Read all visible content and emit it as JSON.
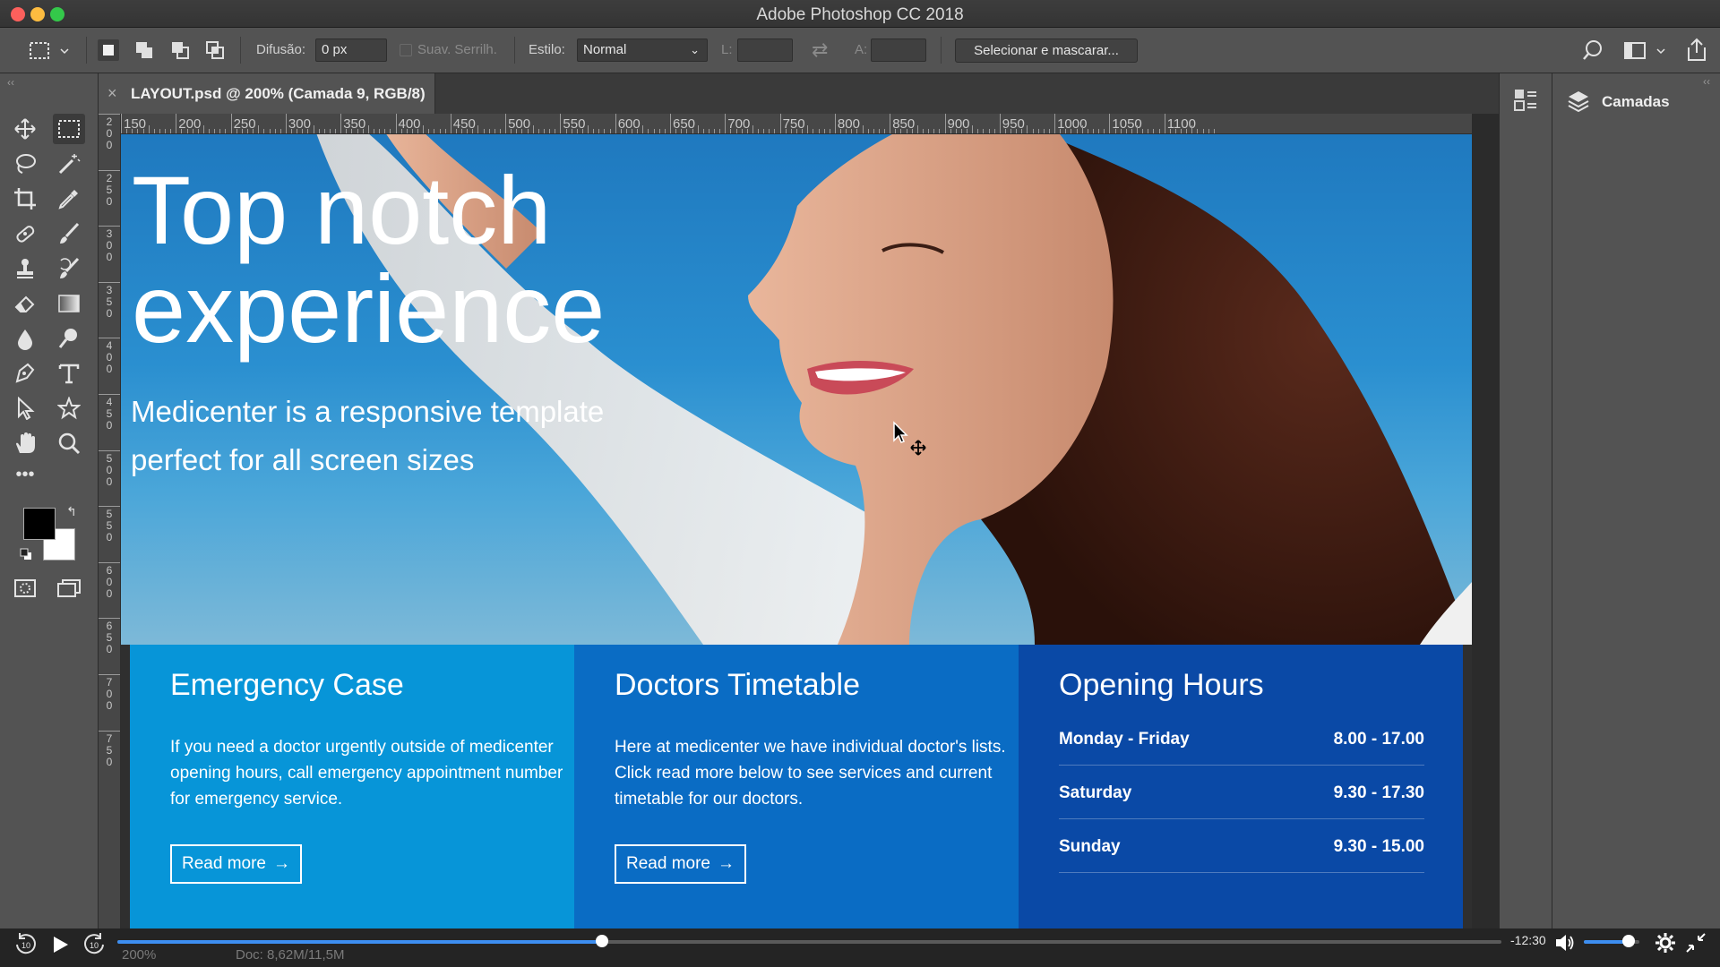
{
  "window": {
    "title": "Adobe Photoshop CC 2018",
    "traffic_colors": [
      "#fc605c",
      "#fdbc40",
      "#34c84a"
    ]
  },
  "options_bar": {
    "feather_label": "Difusão:",
    "feather_value": "0 px",
    "antialias_label": "Suav. Serrilh.",
    "style_label": "Estilo:",
    "style_value": "Normal",
    "width_label": "L:",
    "height_label": "A:",
    "select_mask_button": "Selecionar e mascarar..."
  },
  "document": {
    "tab_title": "LAYOUT.psd @ 200% (Camada 9, RGB/8)",
    "close_glyph": "×"
  },
  "ruler": {
    "h_ticks": [
      "150",
      "200",
      "250",
      "300",
      "350",
      "400",
      "450",
      "500",
      "550",
      "600",
      "650",
      "700",
      "750",
      "800",
      "850",
      "900",
      "950",
      "1000",
      "1050",
      "1100"
    ],
    "v_ticks": [
      "200",
      "250",
      "300",
      "350",
      "400",
      "450",
      "500",
      "550",
      "600",
      "650",
      "700",
      "750"
    ]
  },
  "canvas": {
    "hero_title_line1": "Top notch",
    "hero_title_line2": "experience",
    "hero_sub_line1": "Medicenter is a responsive template",
    "hero_sub_line2": "perfect for all screen sizes",
    "panels": [
      {
        "title": "Emergency Case",
        "text": "If you need a doctor urgently outside of medicenter opening hours, call emergency appointment number for emergency service.",
        "button": "Read more",
        "color": "#0795d8"
      },
      {
        "title": "Doctors Timetable",
        "text": "Here at medicenter we have individual doctor's lists. Click read more below to see services and current timetable for our doctors.",
        "button": "Read more",
        "color": "#0a6cc4"
      },
      {
        "title": "Opening Hours",
        "color": "#0a49a6",
        "rows": [
          {
            "day": "Monday - Friday",
            "hours": "8.00 - 17.00"
          },
          {
            "day": "Saturday",
            "hours": "9.30 - 17.30"
          },
          {
            "day": "Sunday",
            "hours": "9.30 - 15.00"
          }
        ]
      }
    ]
  },
  "layers_panel": {
    "title": "Camadas"
  },
  "status_bar": {
    "zoom": "200%",
    "doc_size": "Doc: 8,62M/11,5M"
  },
  "video": {
    "time_remaining": "-12:30",
    "progress": 0.35,
    "volume": 0.8,
    "rewind_label": "10",
    "forward_label": "10"
  }
}
